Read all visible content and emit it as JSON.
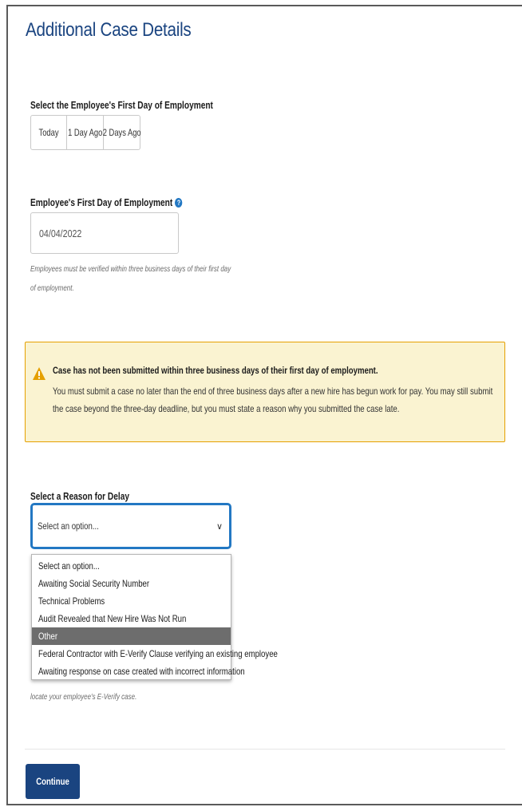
{
  "page": {
    "title": "Additional Case Details"
  },
  "first_day_selector": {
    "label": "Select the Employee's First Day of Employment",
    "options": [
      "Today",
      "1 Day Ago",
      "2 Days Ago"
    ]
  },
  "first_day_field": {
    "label": "Employee's First Day of Employment",
    "help_icon": "question-circle-icon",
    "value": "04/04/2022",
    "hint_line1": "Employees must be verified within three business days of their first day",
    "hint_line2": "of employment."
  },
  "alert": {
    "icon": "warning-triangle-icon",
    "heading": "Case has not been submitted within three business days of their first day of employment.",
    "body": "You must submit a case no later than the end of three business days after a new hire has begun work for pay. You may still submit the case beyond the three-day deadline, but you must state a reason why you submitted the case late.",
    "colors": {
      "background": "#faf3d1",
      "border": "#e5a000",
      "icon": "#e5a000"
    }
  },
  "delay_reason": {
    "label": "Select a Reason for Delay",
    "selected": "Select an option...",
    "options": [
      "Select an option...",
      "Awaiting Social Security Number",
      "Technical Problems",
      "Audit Revealed that New Hire Was Not Run",
      "Other",
      "Federal Contractor with E-Verify Clause verifying an existing employee",
      "Awaiting response on case created with incorrect information"
    ],
    "highlighted_index": 4,
    "hint_tail": "locate your employee's E-Verify case."
  },
  "actions": {
    "continue_label": "Continue"
  },
  "colors": {
    "primary": "#1a4480",
    "focus": "#2378c3",
    "highlight": "#6d6d6d"
  }
}
